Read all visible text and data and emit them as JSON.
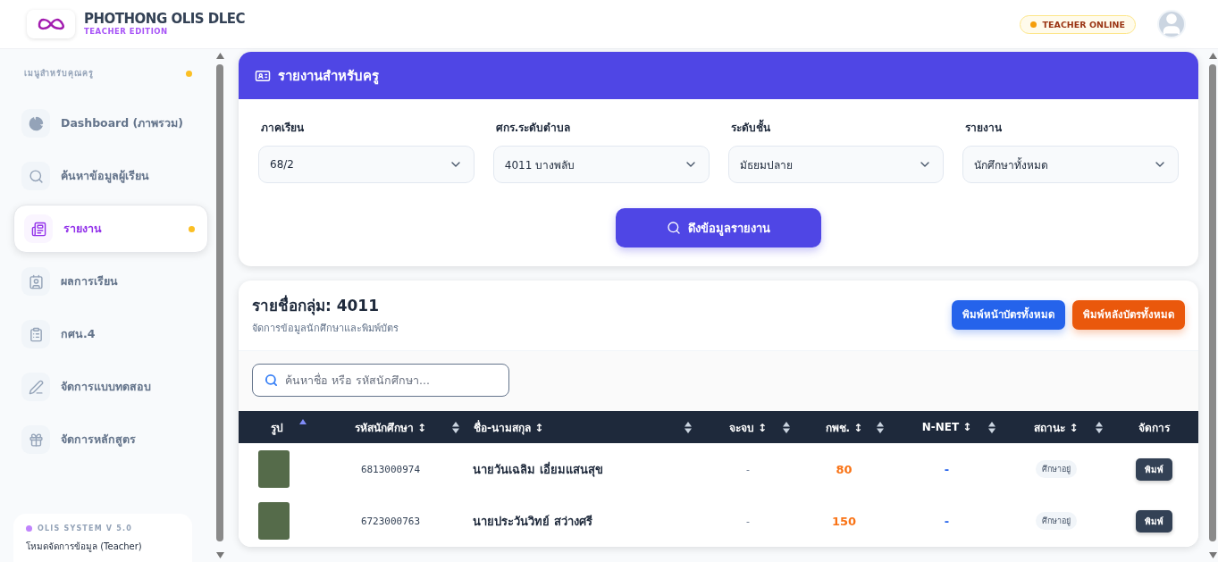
{
  "header": {
    "brand": "PHOTHONG OLIS DLEC",
    "edition": "TEACHER EDITION",
    "status": "TEACHER ONLINE"
  },
  "sidebar": {
    "heading": "เมนูสำหรับคุณครู",
    "items": [
      {
        "label": "Dashboard (ภาพรวม)",
        "selected": false
      },
      {
        "label": "ค้นหาข้อมูลผู้เรียน",
        "selected": false
      },
      {
        "label": "รายงาน",
        "selected": true
      },
      {
        "label": "ผลการเรียน",
        "selected": false
      },
      {
        "label": "กศน.4",
        "selected": false
      },
      {
        "label": "จัดการแบบทดสอบ",
        "selected": false
      },
      {
        "label": "จัดการหลักสูตร",
        "selected": false
      }
    ],
    "footer": {
      "version": "OLIS SYSTEM V 5.0",
      "mode": "โหมดจัดการข้อมูล (Teacher)"
    }
  },
  "report": {
    "title": "รายงานสำหรับครู",
    "filters": [
      {
        "label": "ภาคเรียน",
        "value": "68/2"
      },
      {
        "label": "ศกร.ระดับตำบล",
        "value": "4011 บางพลับ"
      },
      {
        "label": "ระดับชั้น",
        "value": "มัธยมปลาย"
      },
      {
        "label": "รายงาน",
        "value": "นักศึกษาทั้งหมด"
      }
    ],
    "button": "ดึงข้อมูลรายงาน"
  },
  "group": {
    "title": "รายชื่อกลุ่ม: 4011",
    "subtitle": "จัดการข้อมูลนักศึกษาและพิมพ์บัตร",
    "actions": [
      {
        "label": "พิมพ์หน้าบัตรทั้งหมด",
        "kind": "front"
      },
      {
        "label": "พิมพ์หลังบัตรทั้งหมด",
        "kind": "back"
      }
    ],
    "search": {
      "placeholder": "ค้นหาชื่อ หรือ รหัสนักศึกษา..."
    },
    "table": {
      "columns": [
        {
          "label": "รูป",
          "kind": "sortable",
          "sorted": true
        },
        {
          "label": "รหัสนักศึกษา ↕",
          "kind": "sortable",
          "sorted": false
        },
        {
          "label": "ชื่อ-นามสกุล ↕",
          "kind": "sortable",
          "sorted": false
        },
        {
          "label": "จะจบ ↕",
          "kind": "sortable",
          "sorted": false
        },
        {
          "label": "กพช. ↕",
          "kind": "sortable",
          "sorted": false
        },
        {
          "label": "N-NET ↕",
          "kind": "sortable",
          "sorted": false
        },
        {
          "label": "สถานะ ↕",
          "kind": "sortable",
          "sorted": false
        },
        {
          "label": "จัดการ",
          "kind": "plain"
        }
      ],
      "rows": [
        {
          "id": "6813000974",
          "name": "นายวันเฉลิม เอี่ยมแสนสุข",
          "graduate": "-",
          "gpc": "80",
          "nnet": "-",
          "status": "ศึกษาอยู่",
          "action": "พิมพ์"
        },
        {
          "id": "6723000763",
          "name": "นายประวันวิทย์ สว่างศรี",
          "graduate": "-",
          "gpc": "150",
          "nnet": "-",
          "status": "ศึกษาอยู่",
          "action": "พิมพ์"
        }
      ]
    }
  }
}
